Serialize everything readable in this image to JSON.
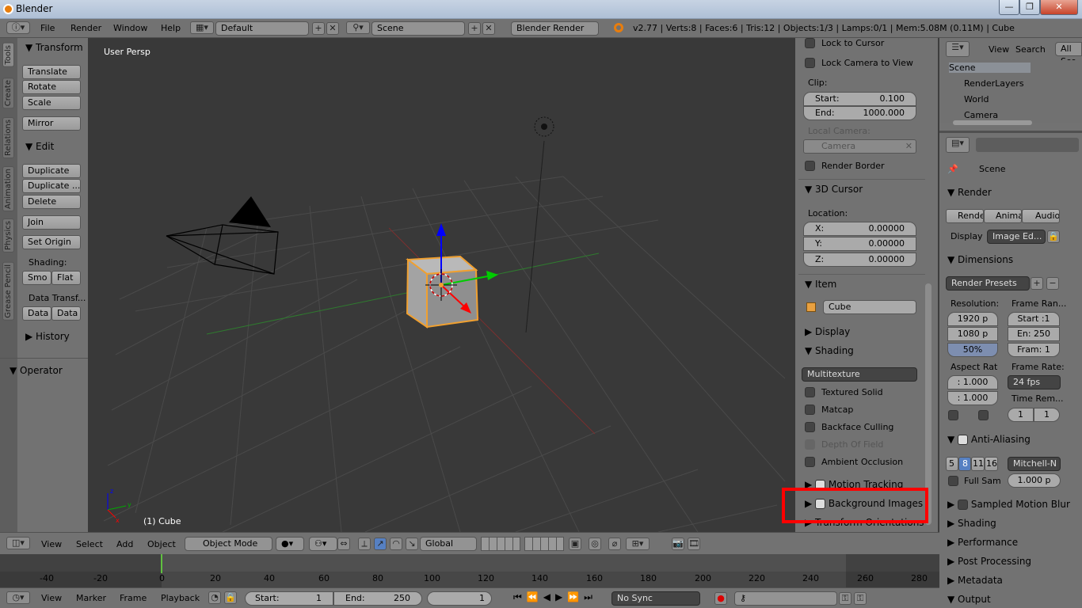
{
  "window": {
    "title": "Blender",
    "min": "—",
    "max": "❐",
    "close": "✕"
  },
  "menu": {
    "items": [
      "File",
      "Render",
      "Window",
      "Help"
    ],
    "screen_layout": "Default",
    "scene": "Scene",
    "engine": "Blender Render",
    "stats": "v2.77 | Verts:8 | Faces:6 | Tris:12 | Objects:1/3 | Lamps:0/1 | Mem:5.08M (0.11M) | Cube"
  },
  "tool_tabs": [
    "Tools",
    "Create",
    "Relations",
    "Animation",
    "Physics",
    "Grease Pencil"
  ],
  "tools": {
    "transform_header": "Transform",
    "translate": "Translate",
    "rotate": "Rotate",
    "scale": "Scale",
    "mirror": "Mirror",
    "edit_header": "Edit",
    "duplicate": "Duplicate",
    "duplicate_linked": "Duplicate ...",
    "delete": "Delete",
    "join": "Join",
    "set_origin": "Set Origin",
    "shading_label": "Shading:",
    "smooth": "Smo",
    "flat": "Flat",
    "data_transfer_label": "Data Transf...",
    "data1": "Data",
    "data2": "Data",
    "history_header": "History",
    "operator_header": "Operator"
  },
  "viewport": {
    "view_name": "User Persp",
    "object_label": "(1) Cube"
  },
  "properties": {
    "lock_to_cursor": "Lock to Cursor",
    "lock_camera": "Lock Camera to View",
    "clip_label": "Clip:",
    "clip_start_label": "Start:",
    "clip_start": "0.100",
    "clip_end_label": "End:",
    "clip_end": "1000.000",
    "local_camera_label": "Local Camera:",
    "local_camera": "Camera",
    "render_border": "Render Border",
    "cursor_header": "3D Cursor",
    "location_label": "Location:",
    "x_label": "X:",
    "x": "0.00000",
    "y_label": "Y:",
    "y": "0.00000",
    "z_label": "Z:",
    "z": "0.00000",
    "item_header": "Item",
    "item_name": "Cube",
    "display_header": "Display",
    "shading_header": "Shading",
    "shading_mode": "Multitexture",
    "textured_solid": "Textured Solid",
    "matcap": "Matcap",
    "backface": "Backface Culling",
    "dof": "Depth Of Field",
    "ao": "Ambient Occlusion",
    "motion_tracking": "Motion Tracking",
    "background_images": "Background Images",
    "transform_orientations": "Transform Orientations"
  },
  "outliner": {
    "view": "View",
    "search": "Search",
    "all_scenes": "All Sce",
    "items": [
      "Scene",
      "RenderLayers",
      "World",
      "Camera"
    ]
  },
  "render_props": {
    "scene": "Scene",
    "render_header": "Render",
    "render_btn": "Rende",
    "anim_btn": "Anima",
    "audio_btn": "Audio",
    "display_label": "Display",
    "display_value": "Image Ed...",
    "dimensions_header": "Dimensions",
    "render_presets": "Render Presets",
    "resolution_label": "Resolution:",
    "res_x": "1920 p",
    "res_y": "1080 p",
    "res_pct": "50%",
    "frame_range_label": "Frame Ran...",
    "frame_start": "Start :1",
    "frame_end": "En: 250",
    "frame_step": "Fram: 1",
    "aspect_label": "Aspect Rat",
    "aspect_x": ": 1.000",
    "aspect_y": ": 1.000",
    "frame_rate_label": "Frame Rate:",
    "fps": "24 fps",
    "time_remap_label": "Time Rem...",
    "remap_old": "1",
    "remap_new": "1",
    "aa_header": "Anti-Aliasing",
    "aa_samples": [
      "5",
      "8",
      "11",
      "16"
    ],
    "aa_filter": "Mitchell-N",
    "full_sample": "Full Sam",
    "filter_size": "1.000 p",
    "smb_header": "Sampled Motion Blur",
    "shading_header": "Shading",
    "performance_header": "Performance",
    "post_header": "Post Processing",
    "metadata_header": "Metadata",
    "output_header": "Output"
  },
  "view3d_header": {
    "view": "View",
    "select": "Select",
    "add": "Add",
    "object": "Object",
    "mode": "Object Mode",
    "orientation": "Global"
  },
  "timeline": {
    "ticks": [
      "-40",
      "-20",
      "0",
      "20",
      "40",
      "60",
      "80",
      "100",
      "120",
      "140",
      "160",
      "180",
      "200",
      "220",
      "240",
      "260",
      "280"
    ],
    "view": "View",
    "marker": "Marker",
    "frame": "Frame",
    "playback": "Playback",
    "start_label": "Start:",
    "start": "1",
    "end_label": "End:",
    "end": "250",
    "current": "1",
    "sync": "No Sync"
  }
}
